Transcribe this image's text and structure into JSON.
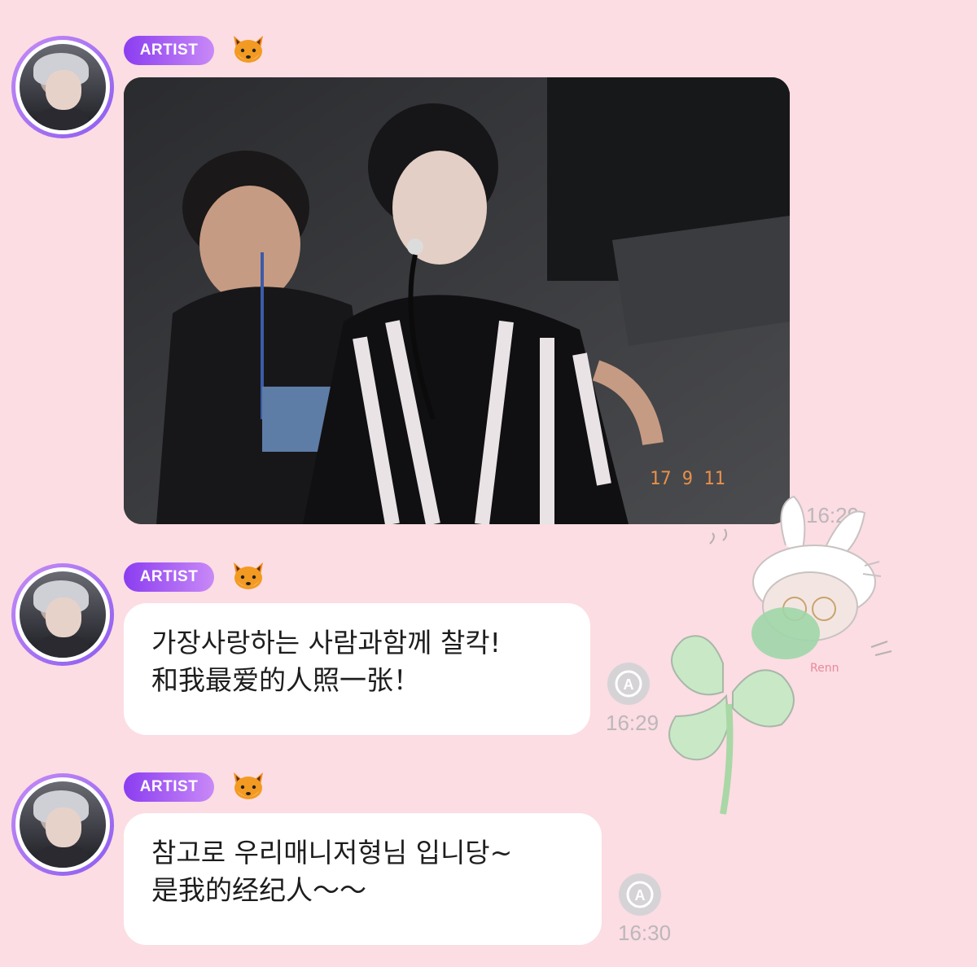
{
  "messages": [
    {
      "sender_badge": "ARTIST",
      "emoji": "fox-emoji",
      "type": "image",
      "image_desc_icon": "photo",
      "film_date": "17 9 11",
      "time": "16:29"
    },
    {
      "sender_badge": "ARTIST",
      "emoji": "fox-emoji",
      "type": "text",
      "lines": [
        "가장사랑하는 사람과함께 찰칵!",
        "和我最爱的人照一张！"
      ],
      "auto_translate_icon": "translate-icon",
      "time": "16:29"
    },
    {
      "sender_badge": "ARTIST",
      "emoji": "fox-emoji",
      "type": "text",
      "lines": [
        "참고로 우리매니저형님 입니당~",
        "是我的经纪人～～"
      ],
      "auto_translate_icon": "translate-icon",
      "time": "16:30"
    }
  ],
  "colors": {
    "background": "#fbdde3",
    "badge_start": "#8b3df0",
    "badge_end": "#c889f7",
    "bubble": "#ffffff",
    "time": "#bcb7bb"
  }
}
